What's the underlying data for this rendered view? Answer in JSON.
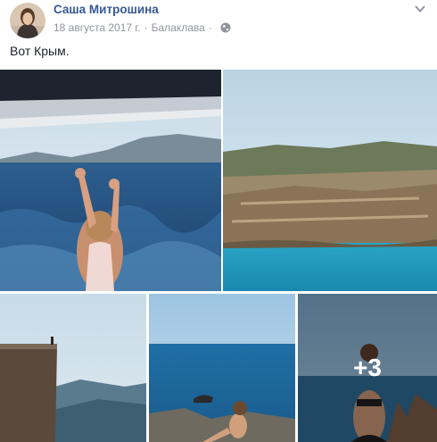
{
  "post": {
    "author": "Саша Митрошина",
    "date": "18 августа 2017 г.",
    "separator": "·",
    "location": "Балаклава",
    "privacy_icon": "globe-icon",
    "menu_icon": "chevron-down-icon",
    "text": "Вот Крым."
  },
  "photos": [
    {
      "subject": "boat-sea-woman"
    },
    {
      "subject": "quarry-lagoon"
    },
    {
      "subject": "cliff-edge"
    },
    {
      "subject": "sea-rocks-woman"
    },
    {
      "subject": "woman-sea-view",
      "more_count": "+3"
    }
  ],
  "colors": {
    "link": "#385898",
    "meta": "#90949c",
    "text": "#1d2129"
  }
}
